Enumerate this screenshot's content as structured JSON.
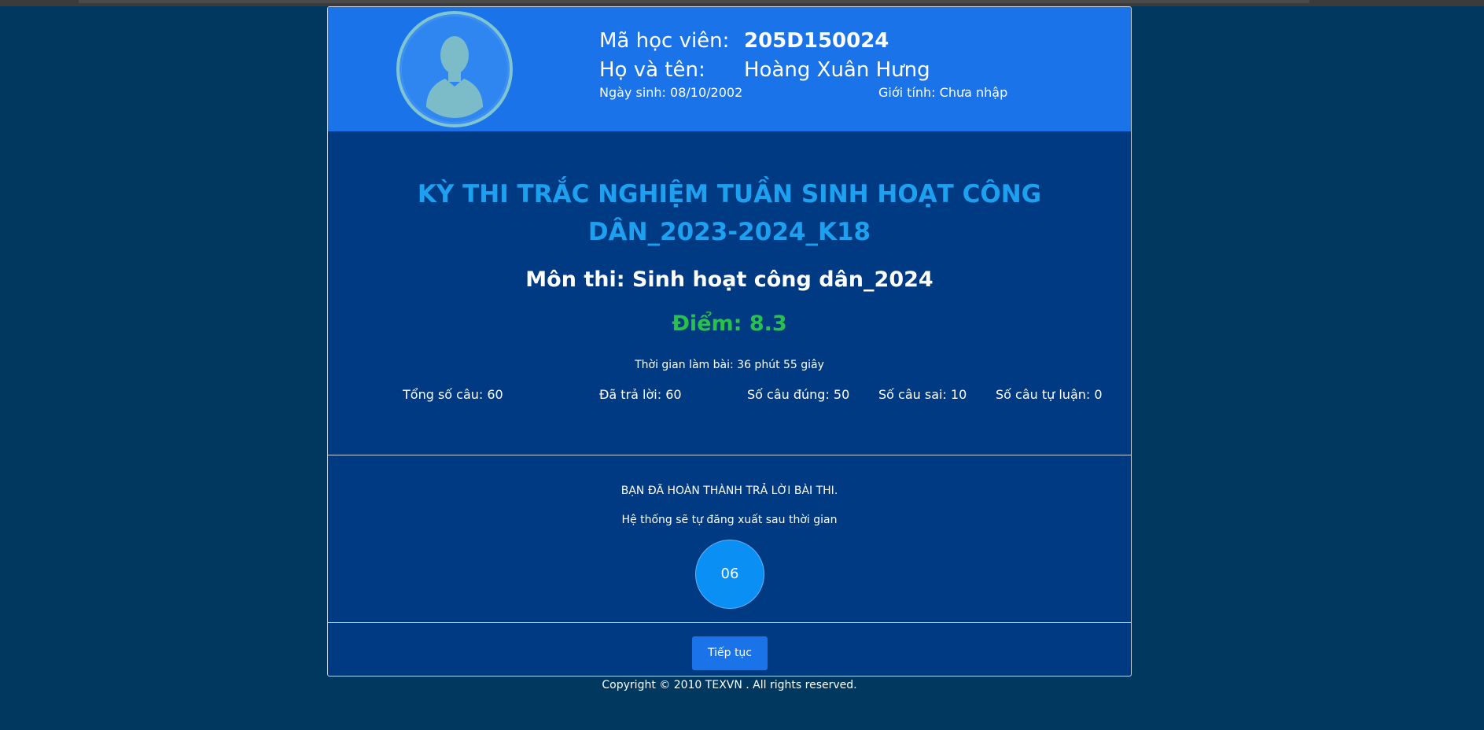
{
  "student": {
    "id_label": "Mã học viên:",
    "id_value": "205D150024",
    "name_label": "Họ và tên:",
    "name_value": "Hoàng Xuân Hưng",
    "dob": "Ngày sinh: 08/10/2002",
    "gender": "Giới tính: Chưa nhập",
    "avatar_icon": "user-silhouette-icon"
  },
  "exam": {
    "title_line1": "KỲ THI TRẮC NGHIỆM TUẦN SINH HOẠT CÔNG",
    "title_line2": "DÂN_2023-2024_K18",
    "subject": "Môn thi: Sinh hoạt công dân_2024",
    "score": "Điểm: 8.3",
    "duration": "Thời gian làm bài: 36 phút 55 giây",
    "stats": {
      "total": "Tổng số câu: 60",
      "answered": "Đã trả lời: 60",
      "correct": "Số câu đúng: 50",
      "wrong": "Số câu sai: 10",
      "essay": "Số câu tự luận: 0"
    }
  },
  "completion": {
    "done_message": "BẠN ĐÃ HOÀN THÀNH TRẢ LỜI BÀI THI.",
    "logout_message": "Hệ thống sẽ tự đăng xuất sau thời gian",
    "countdown": "06"
  },
  "actions": {
    "continue_label": "Tiếp tục"
  },
  "footer": {
    "copyright": "Copyright © 2010 TEXVN . All rights reserved."
  },
  "colors": {
    "page_bg": "#003860",
    "card_bg": "#003a82",
    "header_bg": "#1a73e8",
    "title_color": "#1ea0f0",
    "score_color": "#28c24a",
    "countdown_bg": "#0a8ff5"
  }
}
